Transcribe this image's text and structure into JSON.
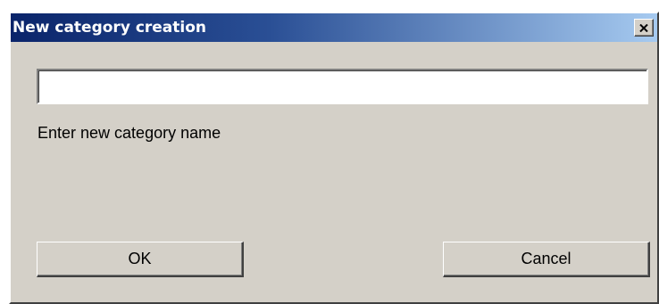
{
  "dialog": {
    "title": "New category creation",
    "close_label": "close",
    "input": {
      "value": "",
      "placeholder": ""
    },
    "prompt": "Enter new category name",
    "ok_label": "OK",
    "cancel_label": "Cancel"
  },
  "colors": {
    "titlebar_start": "#0a246a",
    "titlebar_end": "#a6caf0",
    "face": "#d4d0c8",
    "field": "#ffffff"
  },
  "icons": {
    "close": "close-icon"
  }
}
